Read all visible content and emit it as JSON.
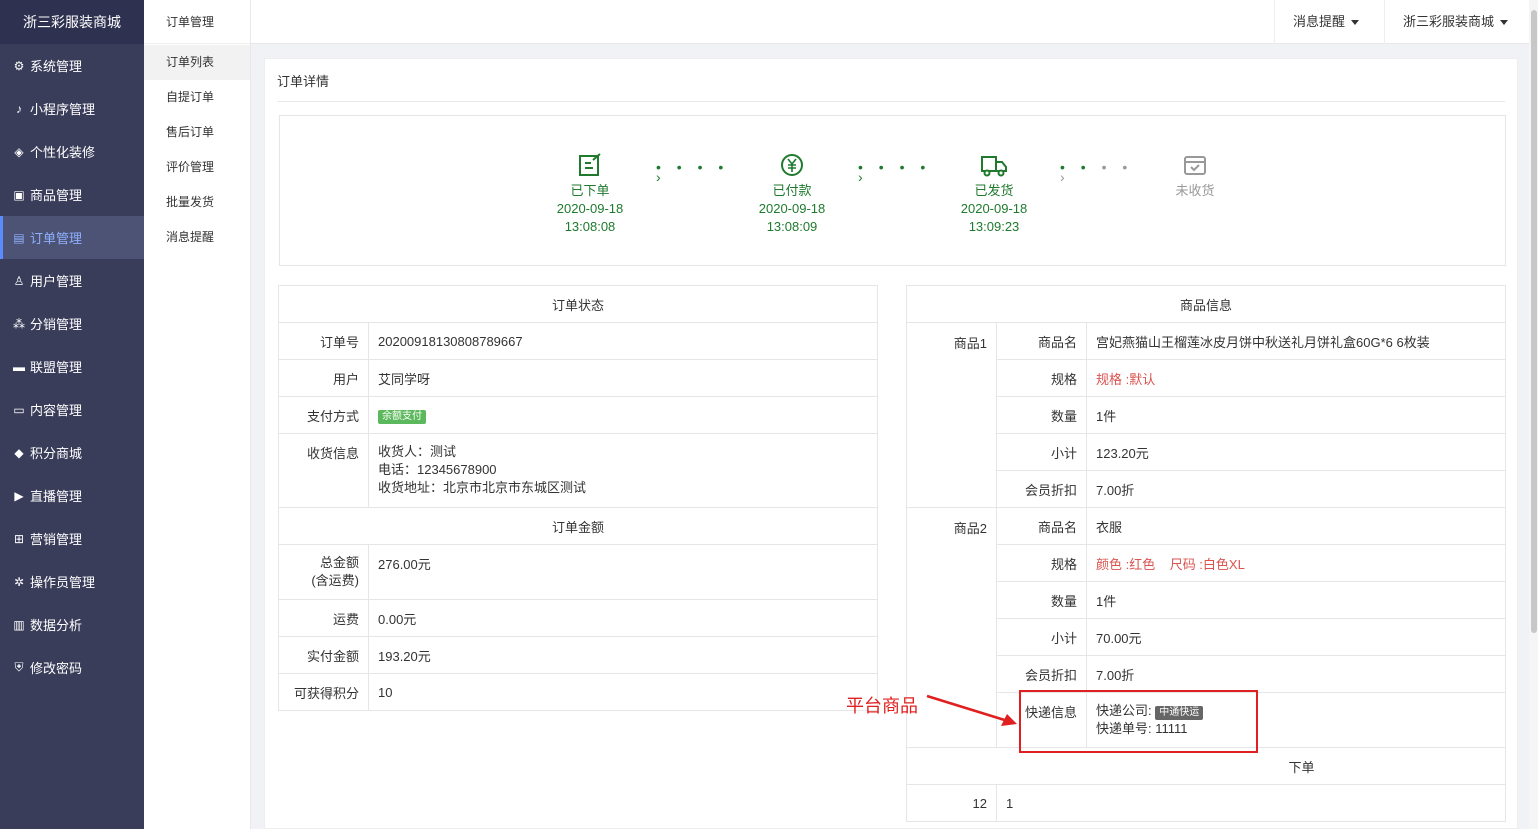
{
  "sidebar": {
    "logo": "浙三彩服装商城",
    "items": [
      {
        "label": "系统管理",
        "icon": "gear-icon"
      },
      {
        "label": "小程序管理",
        "icon": "tiktok-icon"
      },
      {
        "label": "个性化装修",
        "icon": "diamond-icon"
      },
      {
        "label": "商品管理",
        "icon": "bag-icon"
      },
      {
        "label": "订单管理",
        "icon": "order-icon"
      },
      {
        "label": "用户管理",
        "icon": "user-icon"
      },
      {
        "label": "分销管理",
        "icon": "network-icon"
      },
      {
        "label": "联盟管理",
        "icon": "card-icon"
      },
      {
        "label": "内容管理",
        "icon": "content-icon"
      },
      {
        "label": "积分商城",
        "icon": "cube-icon"
      },
      {
        "label": "直播管理",
        "icon": "play-icon"
      },
      {
        "label": "营销管理",
        "icon": "marketing-icon"
      },
      {
        "label": "操作员管理",
        "icon": "cog-icon"
      },
      {
        "label": "数据分析",
        "icon": "chart-icon"
      },
      {
        "label": "修改密码",
        "icon": "shield-icon"
      }
    ]
  },
  "subnav": {
    "title": "订单管理",
    "items": [
      "订单列表",
      "自提订单",
      "售后订单",
      "评价管理",
      "批量发货",
      "消息提醒"
    ]
  },
  "topbar": {
    "notify": "消息提醒",
    "store": "浙三彩服装商城"
  },
  "page": {
    "title": "订单详情"
  },
  "steps": [
    {
      "label": "已下单",
      "date": "2020-09-18",
      "time": "13:08:08"
    },
    {
      "label": "已付款",
      "date": "2020-09-18",
      "time": "13:08:09"
    },
    {
      "label": "已发货",
      "date": "2020-09-18",
      "time": "13:09:23"
    },
    {
      "label": "未收货",
      "date": "",
      "time": ""
    }
  ],
  "order": {
    "header": "订单状态",
    "no_label": "订单号",
    "no": "20200918130808789667",
    "user_label": "用户",
    "user": "艾同学呀",
    "pay_label": "支付方式",
    "pay": "余额支付",
    "recv_label": "收货信息",
    "recv_name": "收货人：测试",
    "recv_phone": "电话：12345678900",
    "recv_addr": "收货地址：北京市北京市东城区测试",
    "amount_header": "订单金额",
    "total_label_1": "总金额",
    "total_label_2": "(含运费)",
    "total": "276.00元",
    "freight_label": "运费",
    "freight": "0.00元",
    "paid_label": "实付金额",
    "paid": "193.20元",
    "points_label": "可获得积分",
    "points": "10"
  },
  "goods": {
    "header": "商品信息",
    "name_label": "商品名",
    "spec_label": "规格",
    "qty_label": "数量",
    "subtotal_label": "小计",
    "discount_label": "会员折扣",
    "items": [
      {
        "tag": "商品1",
        "name": "宫妃燕猫山王榴莲冰皮月饼中秋送礼月饼礼盒60G*6 6枚装",
        "spec1": "规格 :默认",
        "spec2": "",
        "qty": "1件",
        "subtotal": "123.20元",
        "discount": "7.00折"
      },
      {
        "tag": "商品2",
        "name": "衣服",
        "spec1": "颜色 :红色",
        "spec2": "尺码 :白色XL",
        "qty": "1件",
        "subtotal": "70.00元",
        "discount": "7.00折"
      }
    ],
    "express_label": "快递信息",
    "express_company_label": "快递公司:",
    "express_company": "中通快运",
    "express_no": "快递单号:  11111",
    "footer_header": "下单",
    "footer_col1": "12",
    "footer_col2": "1"
  },
  "annotation": {
    "text": "平台商品"
  }
}
